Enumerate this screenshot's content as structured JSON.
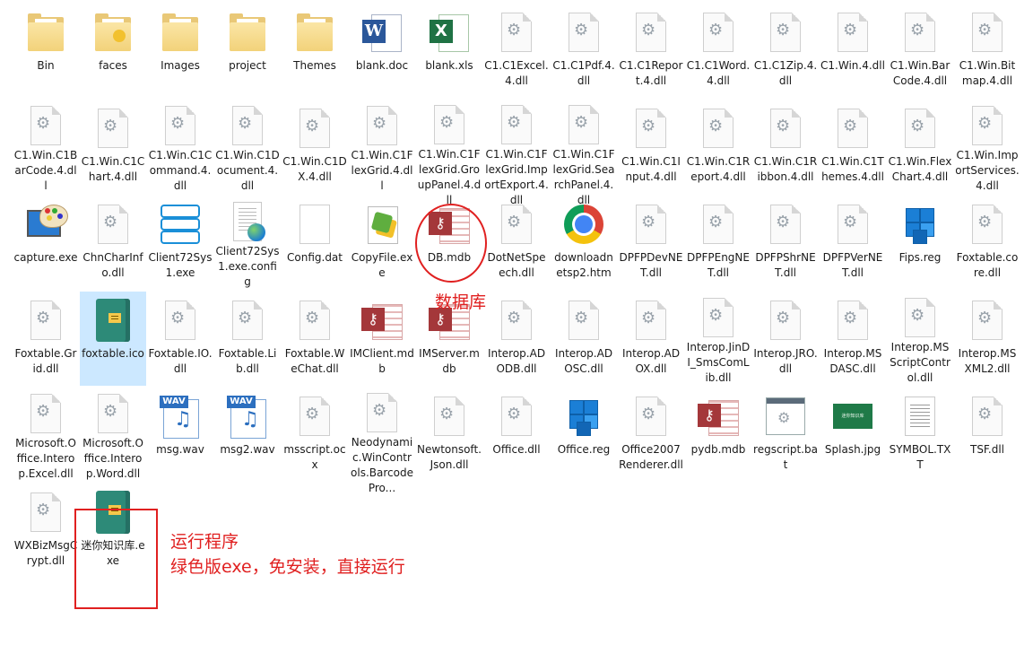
{
  "rows": [
    [
      "Bin",
      "faces",
      "Images",
      "project",
      "Themes",
      "blank.doc",
      "blank.xls",
      "C1.C1Excel.4.dll",
      "C1.C1Pdf.4.dll",
      "C1.C1Report.4.dll",
      "C1.C1Word.4.dll",
      "C1.C1Zip.4.dll",
      "C1.Win.4.dll",
      "C1.Win.BarCode.4.dll",
      "C1.Win.Bitmap.4.dll"
    ],
    [
      "C1.Win.C1BarCode.4.dll",
      "C1.Win.C1Chart.4.dll",
      "C1.Win.C1Command.4.dll",
      "C1.Win.C1Document.4.dll",
      "C1.Win.C1DX.4.dll",
      "C1.Win.C1FlexGrid.4.dll",
      "C1.Win.C1FlexGrid.GroupPanel.4.dll",
      "C1.Win.C1FlexGrid.ImportExport.4.dll",
      "C1.Win.C1FlexGrid.SearchPanel.4.dll",
      "C1.Win.C1Input.4.dll",
      "C1.Win.C1Report.4.dll",
      "C1.Win.C1Ribbon.4.dll",
      "C1.Win.C1Themes.4.dll",
      "C1.Win.FlexChart.4.dll",
      "C1.Win.ImportServices.4.dll"
    ],
    [
      "capture.exe",
      "ChnCharInfo.dll",
      "Client72Sys1.exe",
      "Client72Sys1.exe.config",
      "Config.dat",
      "CopyFile.exe",
      "DB.mdb",
      "DotNetSpeech.dll",
      "downloadnetsp2.htm",
      "DPFPDevNET.dll",
      "DPFPEngNET.dll",
      "DPFPShrNET.dll",
      "DPFPVerNET.dll",
      "Fips.reg",
      "Foxtable.core.dll"
    ],
    [
      "Foxtable.Grid.dll",
      "foxtable.ico",
      "Foxtable.IO.dll",
      "Foxtable.Lib.dll",
      "Foxtable.WeChat.dll",
      "IMClient.mdb",
      "IMServer.mdb",
      "Interop.ADODB.dll",
      "Interop.ADOSC.dll",
      "Interop.ADOX.dll",
      "Interop.JinDI_SmsComLib.dll",
      "Interop.JRO.dll",
      "Interop.MSDASC.dll",
      "Interop.MSScriptControl.dll",
      "Interop.MSXML2.dll"
    ],
    [
      "Microsoft.Office.Interop.Excel.dll",
      "Microsoft.Office.Interop.Word.dll",
      "msg.wav",
      "msg2.wav",
      "msscript.ocx",
      "Neodynamic.WinControls.BarcodePro...",
      "Newtonsoft.Json.dll",
      "Office.dll",
      "Office.reg",
      "Office2007Renderer.dll",
      "pydb.mdb",
      "regscript.bat",
      "Splash.jpg",
      "SYMBOL.TXT",
      "TSF.dll"
    ],
    [
      "WXBizMsgCrypt.dll",
      "迷你知识库.exe"
    ]
  ],
  "icon_types": [
    [
      "folder",
      "folder-faces",
      "folder",
      "folder",
      "folder",
      "word",
      "excel",
      "dll",
      "dll",
      "dll",
      "dll",
      "dll",
      "dll",
      "dll",
      "dll"
    ],
    [
      "dll",
      "dll",
      "dll",
      "dll",
      "dll",
      "dll",
      "dll",
      "dll",
      "dll",
      "dll",
      "dll",
      "dll",
      "dll",
      "dll",
      "dll"
    ],
    [
      "palette",
      "dll",
      "stack",
      "config",
      "blank",
      "copyfile",
      "access",
      "dll",
      "chrome",
      "dll",
      "dll",
      "dll",
      "dll",
      "cube",
      "dll"
    ],
    [
      "dll",
      "book",
      "dll",
      "dll",
      "dll",
      "access",
      "access",
      "dll",
      "dll",
      "dll",
      "dll",
      "dll",
      "dll",
      "dll",
      "dll"
    ],
    [
      "dll",
      "dll",
      "wav",
      "wav",
      "dll",
      "dll",
      "dll",
      "dll",
      "cube",
      "dll",
      "access",
      "bat",
      "splash",
      "txt",
      "dll"
    ],
    [
      "dll",
      "book"
    ]
  ],
  "selected": "foxtable.ico",
  "annotations": {
    "db_label": "数据库",
    "run_title": "运行程序",
    "run_desc": "绿色版exe，免安装，直接运行"
  },
  "splash_text": "迷你知识库"
}
